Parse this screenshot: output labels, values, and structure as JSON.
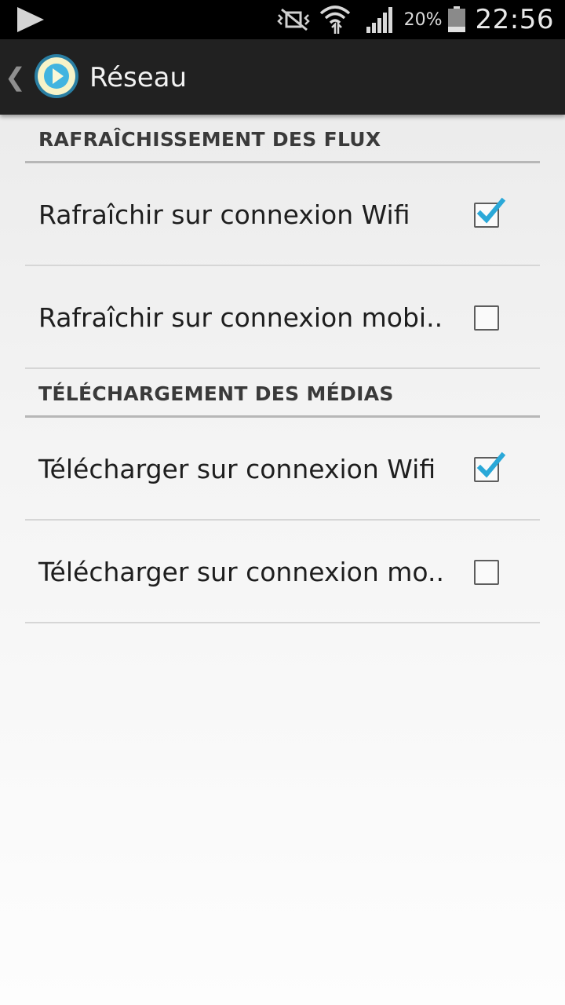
{
  "status_bar": {
    "icons": [
      "media-play-icon",
      "vibrate-mute-icon",
      "wifi-icon",
      "signal-icon",
      "battery-icon"
    ],
    "battery_percent": "20%",
    "time": "22:56"
  },
  "action_bar": {
    "title": "Réseau",
    "icon": "podcast-app-icon"
  },
  "sections": [
    {
      "header": "RAFRAÎCHISSEMENT DES FLUX",
      "items": [
        {
          "label": "Rafraîchir sur connexion Wifi",
          "checked": true
        },
        {
          "label": "Rafraîchir sur connexion mobi..",
          "checked": false
        }
      ]
    },
    {
      "header": "TÉLÉCHARGEMENT DES MÉDIAS",
      "items": [
        {
          "label": "Télécharger sur connexion Wifi",
          "checked": true
        },
        {
          "label": "Télécharger sur connexion mo..",
          "checked": false
        }
      ]
    }
  ],
  "colors": {
    "accent": "#33b5e5",
    "action_bar": "#212121",
    "status_bar": "#000000"
  }
}
